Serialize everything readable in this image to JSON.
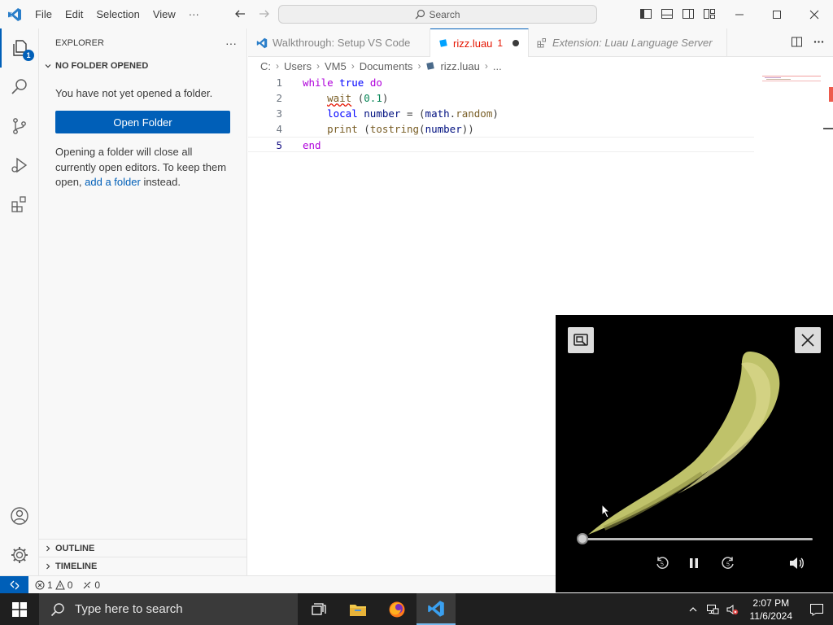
{
  "titlebar": {
    "menu": [
      "File",
      "Edit",
      "Selection",
      "View",
      "···"
    ],
    "search": "Search"
  },
  "activity": {
    "explorer_badge": "1"
  },
  "sidebar": {
    "title": "EXPLORER",
    "more": "···",
    "section": "NO FOLDER OPENED",
    "no_folder_text": "You have not yet opened a folder.",
    "open_folder": "Open Folder",
    "info_line1": "Opening a folder will close all",
    "info_line2": "currently open editors. To keep them",
    "info_line3_pre": "open, ",
    "info_link": "add a folder",
    "info_line3_post": " instead.",
    "outline": "OUTLINE",
    "timeline": "TIMELINE"
  },
  "tabs": [
    {
      "label": "Walkthrough: Setup VS Code"
    },
    {
      "label": "rizz.luau",
      "errors": "1"
    },
    {
      "label": "Extension: Luau Language Server"
    }
  ],
  "breadcrumb": [
    "C:",
    "Users",
    "VM5",
    "Documents",
    "rizz.luau",
    "..."
  ],
  "code": {
    "line_numbers": [
      "1",
      "2",
      "3",
      "4",
      "5"
    ],
    "l1_kw": "while",
    "l1_kw2": "true",
    "l1_kw3": "do",
    "l2_fn": "wait",
    "l2_rest_a": " (",
    "l2_num": "0.1",
    "l2_rest_b": ")",
    "l3_kw": "local",
    "l3_var": "number",
    "l3_eq": " = (",
    "l3_math": "math",
    "l3_dot": ".",
    "l3_random": "random",
    "l3_close": ")",
    "l4_fn": "print",
    "l4_a": " (",
    "l4_fn2": "tostring",
    "l4_b": "(",
    "l4_var": "number",
    "l4_c": "))",
    "l5_kw": "end"
  },
  "status": {
    "errors": "1",
    "warnings": "0",
    "ports": "0"
  },
  "taskbar": {
    "search_placeholder": "Type here to search",
    "time": "2:07 PM",
    "date": "11/6/2024"
  },
  "colors": {
    "accent": "#005fb8",
    "error": "#e51400",
    "keyword": "#af00db",
    "keyword_literal": "#0000ff",
    "function": "#795e26",
    "number": "#098658",
    "variable": "#001080"
  }
}
